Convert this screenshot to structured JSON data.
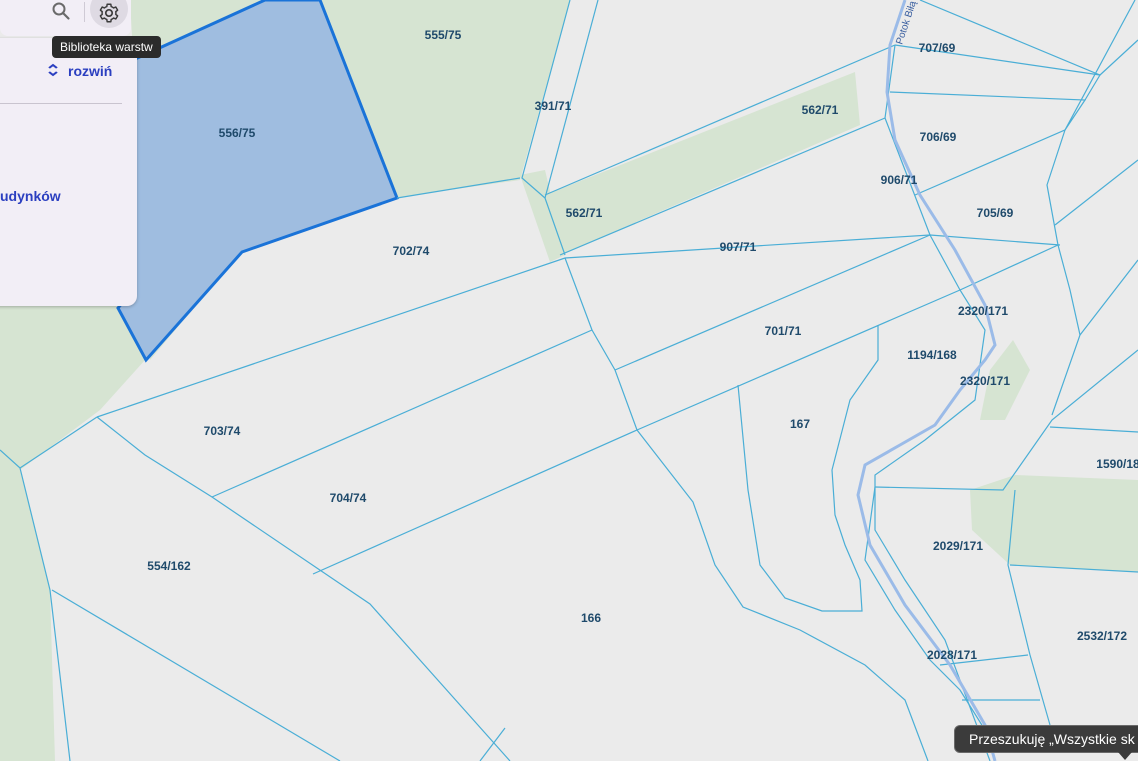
{
  "toolbar": {
    "search_icon": "search-icon",
    "settings_icon": "gear-icon",
    "tooltip": "Biblioteka warstw"
  },
  "panel": {
    "expand_label": "rozwiń",
    "expand_icon": "chevron-up-down-icon",
    "buildings_text": "udynków"
  },
  "map": {
    "stream_name": "Potok Biłą",
    "colors": {
      "background": "#ebebeb",
      "forest": "#d6e4d2",
      "parcel_line": "#4aaed6",
      "selected_fill": "#9fbde0",
      "selected_stroke": "#1a73d8",
      "stream": "#9bbbe8"
    },
    "parcels": [
      "555/75",
      "556/75",
      "391/71",
      "562/71",
      "562/71",
      "707/69",
      "706/69",
      "906/71",
      "705/69",
      "702/74",
      "907/71",
      "701/71",
      "2320/171",
      "1194/168",
      "2320/171",
      "703/74",
      "167",
      "1590/18",
      "704/74",
      "2029/171",
      "554/162",
      "166",
      "2532/172",
      "2028/171"
    ]
  },
  "status": {
    "message": "Przeszukuję „Wszystkie sk"
  }
}
